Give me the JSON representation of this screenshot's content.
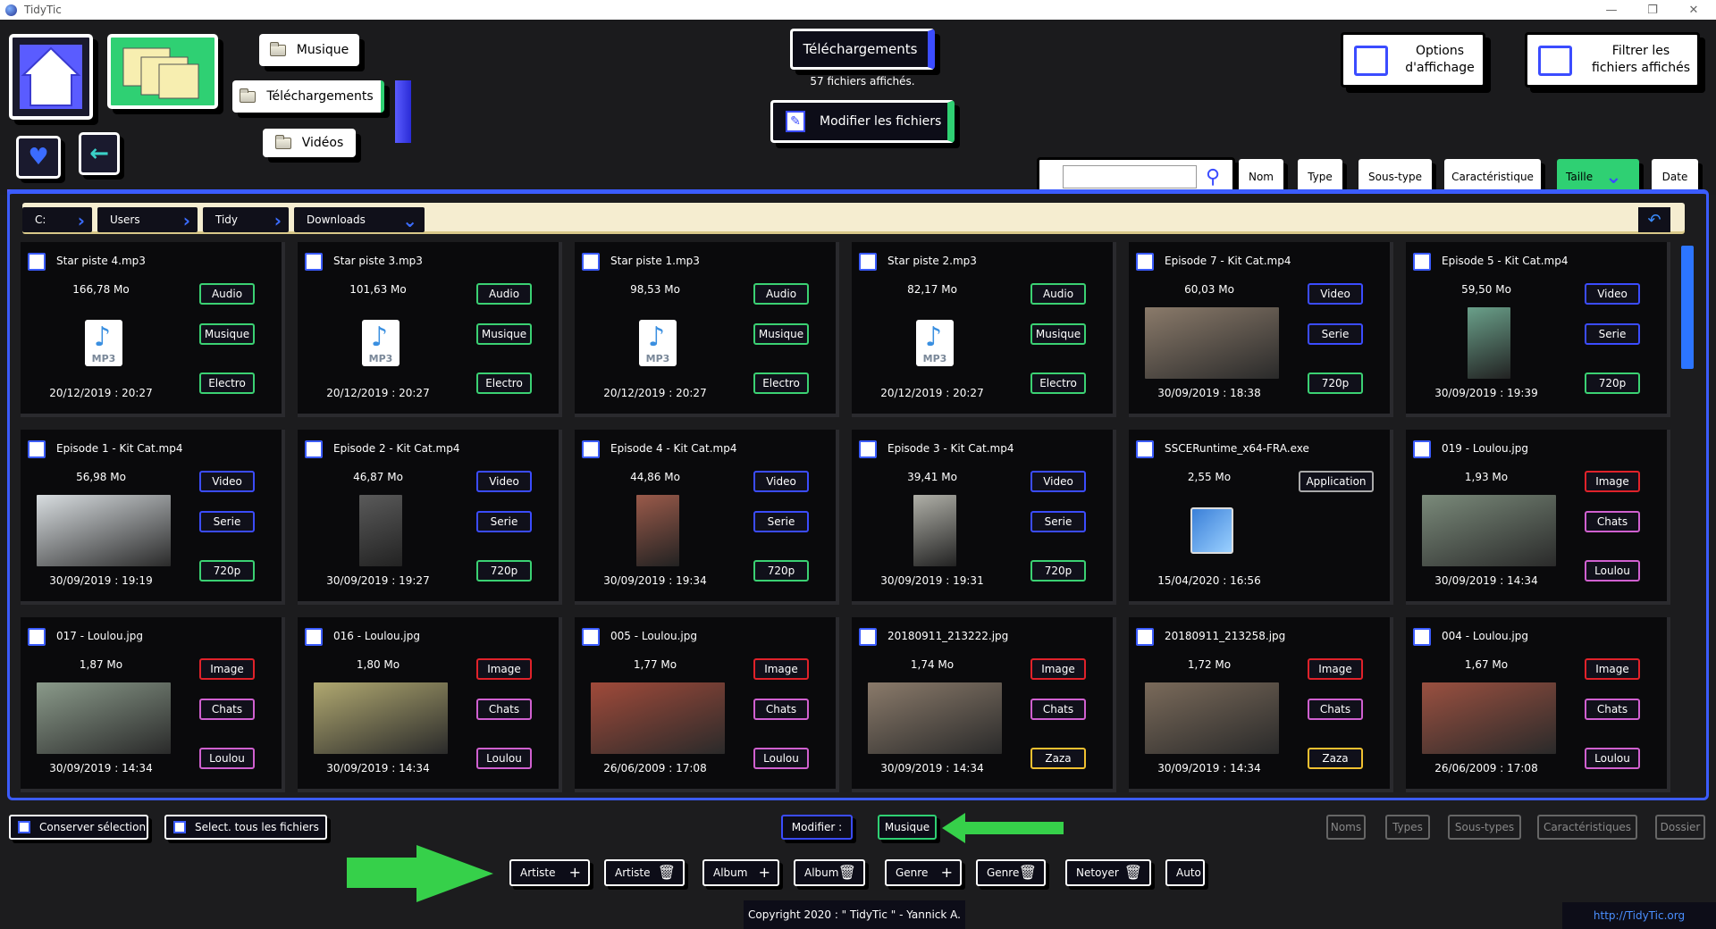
{
  "window": {
    "title": "TidyTic",
    "minimize": "—",
    "restore": "❐",
    "close": "✕"
  },
  "nav": {
    "musique": "Musique",
    "telechargements": "Téléchargements",
    "videos": "Vidéos"
  },
  "center": {
    "current_folder": "Téléchargements",
    "count_text": "57 fichiers affichés.",
    "modify_button": "Modifier les fichiers"
  },
  "right": {
    "options_line1": "Options",
    "options_line2": "d'affichage",
    "filter_line1": "Filtrer les",
    "filter_line2": "fichiers affichés"
  },
  "search": {
    "value": ""
  },
  "sort": {
    "nom": "Nom",
    "type": "Type",
    "soustype": "Sous-type",
    "carac": "Caractéristique",
    "taille": "Taille",
    "date": "Date"
  },
  "path": [
    "C:",
    "Users",
    "Tidy",
    "Downloads"
  ],
  "cards": [
    {
      "name": "Star piste 4.mp3",
      "size": "166,78 Mo",
      "date": "20/12/2019 : 20:27",
      "tags": [
        "Audio",
        "Musique",
        "Electro"
      ],
      "colors": [
        "green",
        "green",
        "green"
      ],
      "thumb": "mp3"
    },
    {
      "name": "Star piste 3.mp3",
      "size": "101,63 Mo",
      "date": "20/12/2019 : 20:27",
      "tags": [
        "Audio",
        "Musique",
        "Electro"
      ],
      "colors": [
        "green",
        "green",
        "green"
      ],
      "thumb": "mp3"
    },
    {
      "name": "Star piste 1.mp3",
      "size": "98,53 Mo",
      "date": "20/12/2019 : 20:27",
      "tags": [
        "Audio",
        "Musique",
        "Electro"
      ],
      "colors": [
        "green",
        "green",
        "green"
      ],
      "thumb": "mp3"
    },
    {
      "name": "Star piste 2.mp3",
      "size": "82,17 Mo",
      "date": "20/12/2019 : 20:27",
      "tags": [
        "Audio",
        "Musique",
        "Electro"
      ],
      "colors": [
        "green",
        "green",
        "green"
      ],
      "thumb": "mp3"
    },
    {
      "name": "Episode 7 - Kit Cat.mp4",
      "size": "60,03 Mo",
      "date": "30/09/2019 : 18:38",
      "tags": [
        "Video",
        "Serie",
        "720p"
      ],
      "colors": [
        "blue",
        "blue",
        "green"
      ],
      "thumb": "photo",
      "tint": "#8a7a6a"
    },
    {
      "name": "Episode 5 - Kit Cat.mp4",
      "size": "59,50 Mo",
      "date": "30/09/2019 : 19:39",
      "tags": [
        "Video",
        "Serie",
        "720p"
      ],
      "colors": [
        "blue",
        "blue",
        "green"
      ],
      "thumb": "tall",
      "tint": "#6aa08a"
    },
    {
      "name": "Episode 1 - Kit Cat.mp4",
      "size": "56,98 Mo",
      "date": "30/09/2019 : 19:19",
      "tags": [
        "Video",
        "Serie",
        "720p"
      ],
      "colors": [
        "blue",
        "blue",
        "green"
      ],
      "thumb": "photo",
      "tint": "#d8dde0"
    },
    {
      "name": "Episode 2 - Kit Cat.mp4",
      "size": "46,87 Mo",
      "date": "30/09/2019 : 19:27",
      "tags": [
        "Video",
        "Serie",
        "720p"
      ],
      "colors": [
        "blue",
        "blue",
        "green"
      ],
      "thumb": "tall",
      "tint": "#5a5a5a"
    },
    {
      "name": "Episode 4 - Kit Cat.mp4",
      "size": "44,86 Mo",
      "date": "30/09/2019 : 19:34",
      "tags": [
        "Video",
        "Serie",
        "720p"
      ],
      "colors": [
        "blue",
        "blue",
        "green"
      ],
      "thumb": "tall",
      "tint": "#9a5a4a"
    },
    {
      "name": "Episode 3 - Kit Cat.mp4",
      "size": "39,41 Mo",
      "date": "30/09/2019 : 19:31",
      "tags": [
        "Video",
        "Serie",
        "720p"
      ],
      "colors": [
        "blue",
        "blue",
        "green"
      ],
      "thumb": "tall",
      "tint": "#b0b0a8"
    },
    {
      "name": "SSCERuntime_x64-FRA.exe",
      "size": "2,55 Mo",
      "date": "15/04/2020 : 16:56",
      "tags": [
        "Application",
        "",
        ""
      ],
      "colors": [
        "gray",
        "",
        ""
      ],
      "thumb": "exe"
    },
    {
      "name": "019 - Loulou.jpg",
      "size": "1,93 Mo",
      "date": "30/09/2019 : 14:34",
      "tags": [
        "Image",
        "Chats",
        "Loulou"
      ],
      "colors": [
        "red",
        "pink",
        "pink"
      ],
      "thumb": "photo",
      "tint": "#7a8a7a"
    },
    {
      "name": "017 - Loulou.jpg",
      "size": "1,87 Mo",
      "date": "30/09/2019 : 14:34",
      "tags": [
        "Image",
        "Chats",
        "Loulou"
      ],
      "colors": [
        "red",
        "pink",
        "pink"
      ],
      "thumb": "photo",
      "tint": "#8a9a8a"
    },
    {
      "name": "016 - Loulou.jpg",
      "size": "1,80 Mo",
      "date": "30/09/2019 : 14:34",
      "tags": [
        "Image",
        "Chats",
        "Loulou"
      ],
      "colors": [
        "red",
        "pink",
        "pink"
      ],
      "thumb": "photo",
      "tint": "#b0a870"
    },
    {
      "name": "005 - Loulou.jpg",
      "size": "1,77 Mo",
      "date": "26/06/2009 : 17:08",
      "tags": [
        "Image",
        "Chats",
        "Loulou"
      ],
      "colors": [
        "red",
        "pink",
        "pink"
      ],
      "thumb": "photo",
      "tint": "#a04a3a"
    },
    {
      "name": "20180911_213222.jpg",
      "size": "1,74 Mo",
      "date": "30/09/2019 : 14:34",
      "tags": [
        "Image",
        "Chats",
        "Zaza"
      ],
      "colors": [
        "red",
        "pink",
        "yellow"
      ],
      "thumb": "photo",
      "tint": "#8a7a6a"
    },
    {
      "name": "20180911_213258.jpg",
      "size": "1,72 Mo",
      "date": "30/09/2019 : 14:34",
      "tags": [
        "Image",
        "Chats",
        "Zaza"
      ],
      "colors": [
        "red",
        "pink",
        "yellow"
      ],
      "thumb": "photo",
      "tint": "#7a6a5a"
    },
    {
      "name": "004 - Loulou.jpg",
      "size": "1,67 Mo",
      "date": "26/06/2009 : 17:08",
      "tags": [
        "Image",
        "Chats",
        "Loulou"
      ],
      "colors": [
        "red",
        "pink",
        "pink"
      ],
      "thumb": "photo",
      "tint": "#9a5040"
    }
  ],
  "bottom": {
    "keep_selection": "Conserver sélection",
    "select_all": "Select. tous les fichiers",
    "modifier": "Modifier :",
    "musique": "Musique",
    "noms": "Noms",
    "types": "Types",
    "soustypes": "Sous-types",
    "caracs": "Caractéristiques",
    "dossier": "Dossier",
    "actions": [
      {
        "label": "Artiste",
        "icon": "+"
      },
      {
        "label": "Artiste",
        "icon": "🗑"
      },
      {
        "label": "Album",
        "icon": "+"
      },
      {
        "label": "Album",
        "icon": "🗑"
      },
      {
        "label": "Genre",
        "icon": "+"
      },
      {
        "label": "Genre",
        "icon": "🗑"
      },
      {
        "label": "Netoyer",
        "icon": "🗑"
      },
      {
        "label": "Auto",
        "icon": ""
      }
    ],
    "copyright": "Copyright 2020 : \" TidyTic \" - Yannick A.",
    "link": "http://TidyTic.org"
  },
  "colors": {
    "accent": "#3b5cff",
    "green": "#3bd173",
    "red": "#e0222a",
    "pink": "#d060d0",
    "yellow": "#f0c030",
    "blue": "#3b4cff",
    "gray": "#aaaaaa"
  }
}
